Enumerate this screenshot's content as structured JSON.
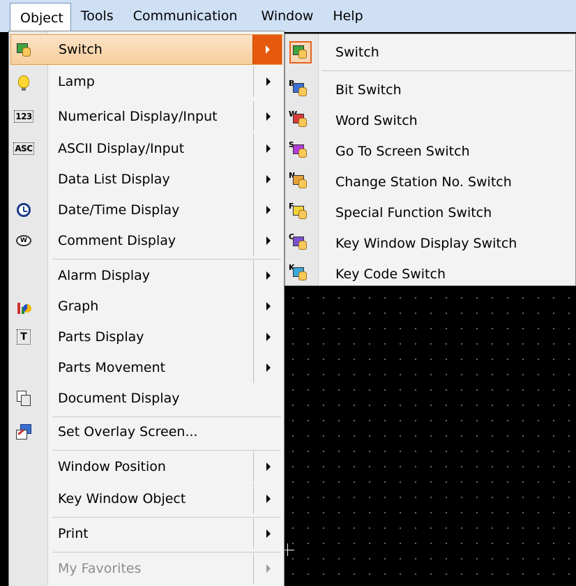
{
  "menubar": {
    "items": [
      "Object",
      "Tools",
      "Communication",
      "Window",
      "Help"
    ]
  },
  "object_menu": {
    "items": [
      {
        "label": "Switch",
        "icon": "switch-icon",
        "submenu": true,
        "highlighted": true
      },
      {
        "label": "Lamp",
        "icon": "lamp-icon",
        "submenu": true
      },
      {
        "label": "Numerical Display/Input",
        "icon": "numerical-icon",
        "submenu": true
      },
      {
        "label": "ASCII Display/Input",
        "icon": "ascii-icon",
        "submenu": true
      },
      {
        "label": "Data List Display",
        "icon": "",
        "submenu": true
      },
      {
        "label": "Date/Time Display",
        "icon": "clock-icon",
        "submenu": true
      },
      {
        "label": "Comment Display",
        "icon": "comment-icon",
        "submenu": true
      },
      {
        "label": "Alarm Display",
        "icon": "",
        "submenu": true
      },
      {
        "label": "Graph",
        "icon": "graph-icon",
        "submenu": true
      },
      {
        "label": "Parts Display",
        "icon": "parts-icon",
        "submenu": true
      },
      {
        "label": "Parts Movement",
        "icon": "",
        "submenu": true
      },
      {
        "label": "Document Display",
        "icon": "document-icon",
        "submenu": false
      },
      {
        "label": "Set Overlay Screen...",
        "icon": "overlay-icon",
        "submenu": false
      },
      {
        "label": "Window Position",
        "icon": "",
        "submenu": true
      },
      {
        "label": "Key Window Object",
        "icon": "",
        "submenu": true
      },
      {
        "label": "Print",
        "icon": "",
        "submenu": true
      },
      {
        "label": "My Favorites",
        "icon": "",
        "submenu": true,
        "disabled": true
      }
    ],
    "icon_text": {
      "numerical": "123",
      "ascii": "ASC",
      "comment": "W",
      "parts": "T"
    }
  },
  "switch_submenu": {
    "items": [
      {
        "label": "Switch",
        "letter": ""
      },
      {
        "label": "Bit Switch",
        "letter": "B"
      },
      {
        "label": "Word Switch",
        "letter": "W"
      },
      {
        "label": "Go To Screen Switch",
        "letter": "S"
      },
      {
        "label": "Change Station No. Switch",
        "letter": "N"
      },
      {
        "label": "Special Function Switch",
        "letter": "F"
      },
      {
        "label": "Key Window Display Switch",
        "letter": "C"
      },
      {
        "label": "Key Code Switch",
        "letter": "K"
      }
    ]
  },
  "colors": {
    "menubar_bg": "#cfe0f5",
    "highlight_arrow": "#e55a0e",
    "highlight_bg": "#f6cf9d",
    "canvas_bg": "#000000"
  }
}
